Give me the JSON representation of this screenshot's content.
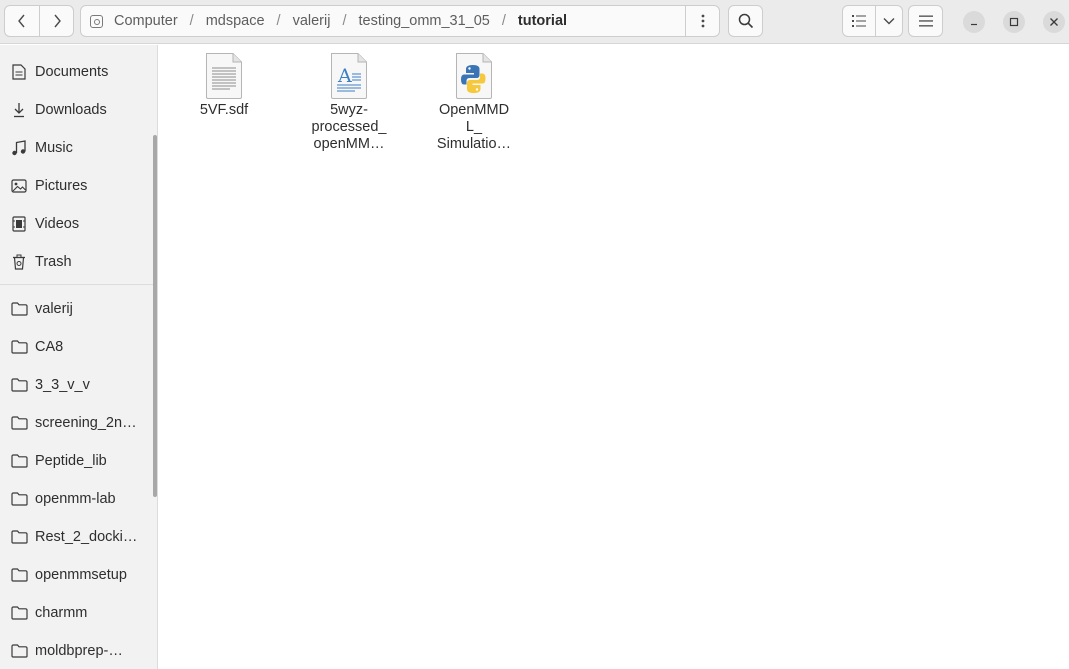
{
  "breadcrumb": [
    "Computer",
    "mdspace",
    "valerij",
    "testing_omm_31_05"
  ],
  "current_folder": "tutorial",
  "sidebar": {
    "places": [
      {
        "label": "Documents",
        "icon": "document-icon"
      },
      {
        "label": "Downloads",
        "icon": "download-icon"
      },
      {
        "label": "Music",
        "icon": "music-icon"
      },
      {
        "label": "Pictures",
        "icon": "picture-icon"
      },
      {
        "label": "Videos",
        "icon": "video-icon"
      },
      {
        "label": "Trash",
        "icon": "trash-icon"
      }
    ],
    "bookmarks": [
      {
        "label": "valerij"
      },
      {
        "label": "CA8"
      },
      {
        "label": "3_3_v_v"
      },
      {
        "label": "screening_2n…"
      },
      {
        "label": "Peptide_lib"
      },
      {
        "label": "openmm-lab"
      },
      {
        "label": "Rest_2_docki…"
      },
      {
        "label": "openmmsetup"
      },
      {
        "label": "charmm"
      },
      {
        "label": "moldbprep-…"
      }
    ]
  },
  "files": [
    {
      "lines": [
        "5VF.sdf"
      ],
      "icon": "text-file-icon"
    },
    {
      "lines": [
        "5wyz-",
        "processed_",
        "openMM…"
      ],
      "icon": "rich-text-file-icon"
    },
    {
      "lines": [
        "OpenMMD",
        "L_",
        "Simulatio…"
      ],
      "icon": "python-file-icon"
    }
  ],
  "colors": {
    "python_blue": "#3b74b5",
    "python_yellow": "#f5c93b",
    "doc_blue": "#3d7fc4"
  }
}
